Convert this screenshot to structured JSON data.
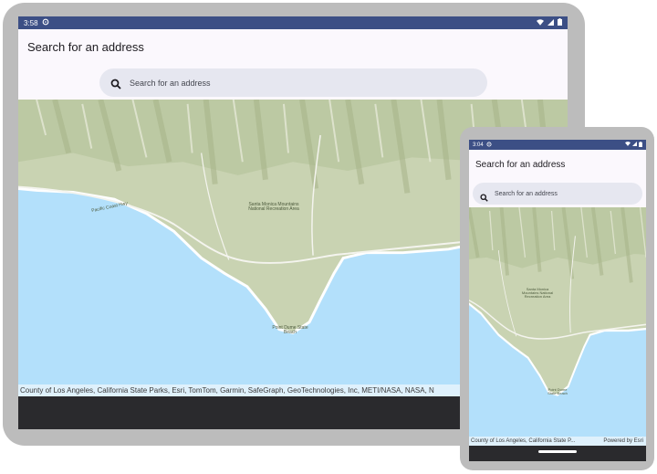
{
  "tablet": {
    "status": {
      "time": "3:58"
    },
    "app_title": "Search for an address",
    "search": {
      "placeholder": "Search for an address"
    },
    "map": {
      "attribution": "County of Los Angeles, California State Parks, Esri, TomTom, Garmin, SafeGraph, GeoTechnologies, Inc, METI/NASA, NASA, N",
      "labels": {
        "park": "Santa Monica Mountains National Recreation Area",
        "beach": "Point Dume State Beach",
        "road": "Pacific Coast Hwy"
      }
    }
  },
  "phone": {
    "status": {
      "time": "3:04"
    },
    "app_title": "Search for an address",
    "search": {
      "placeholder": "Search for an address"
    },
    "map": {
      "attribution": "County of Los Angeles, California State P...",
      "powered_by": "Powered by Esri",
      "labels": {
        "park": "Santa Monica Mountains National Recreation Area",
        "beach": "Point Dume State Beach"
      }
    }
  },
  "icons": {
    "status_left": "gear-icon",
    "status_right": [
      "wifi-icon",
      "signal-icon",
      "battery-icon"
    ],
    "search": "search-icon"
  },
  "colors": {
    "status_bar": "#3c4f85",
    "app_bar": "#fbf8fd",
    "search_pill": "#e6e7f0",
    "water": "#b3e0fb",
    "terrain": "#c9d3b2",
    "frame": "#bcbcbc",
    "nav_bar": "#2a2a2d"
  }
}
